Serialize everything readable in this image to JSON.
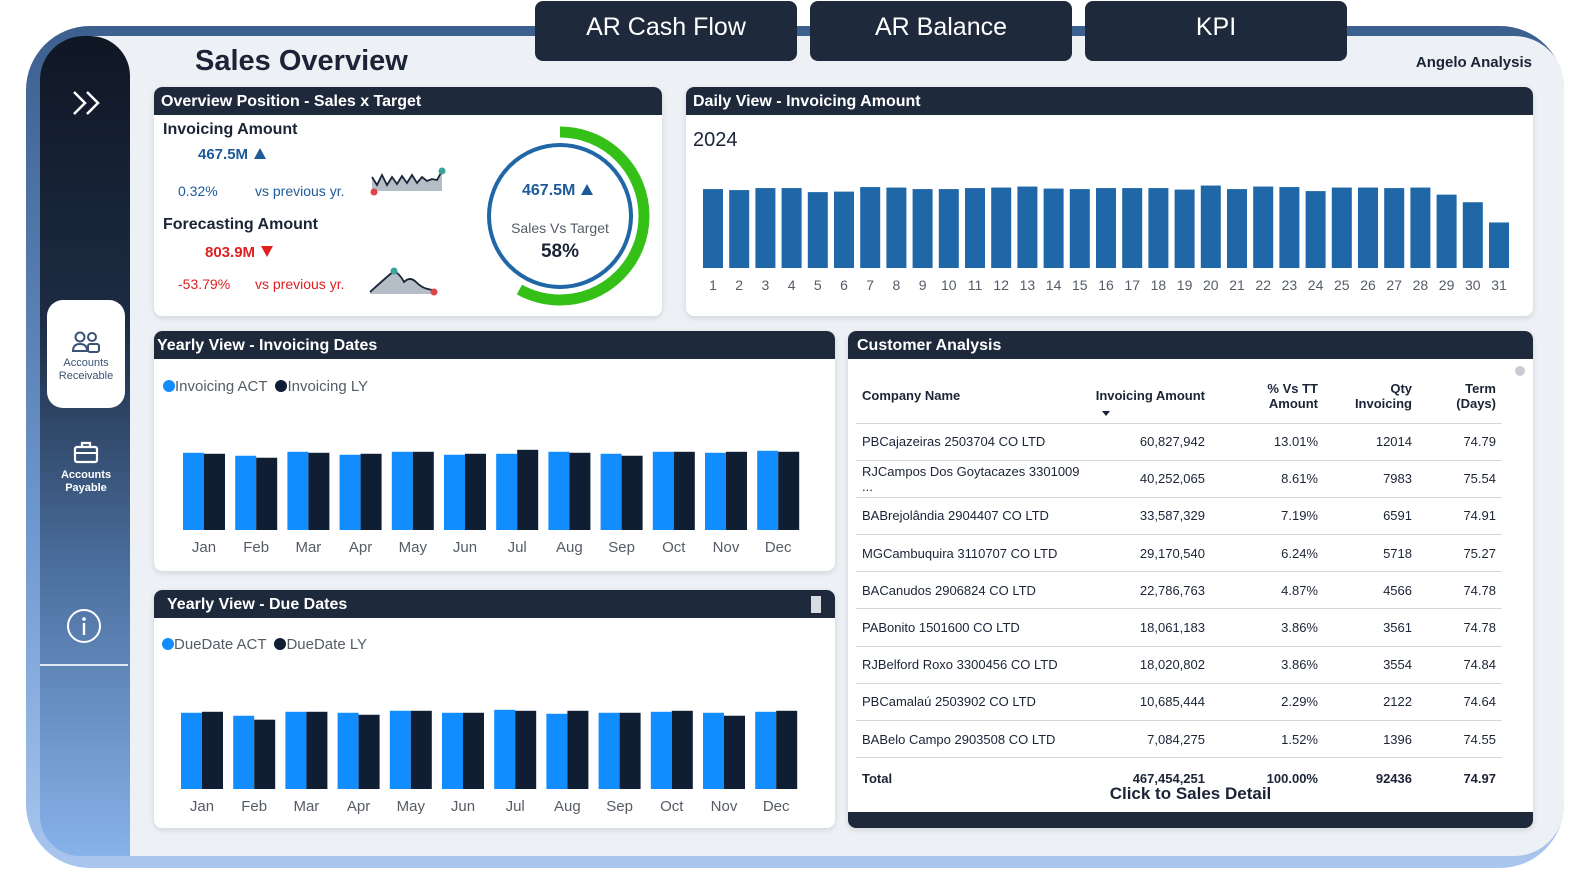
{
  "nav": {
    "top_tabs": [
      "AR Cash Flow",
      "AR Balance",
      "KPI"
    ],
    "sidebar": [
      {
        "label": "Accounts Receivable",
        "icon": "users-icon",
        "active": true
      },
      {
        "label": "Accounts Payable",
        "icon": "briefcase-icon",
        "active": false
      }
    ]
  },
  "header": {
    "title": "Sales Overview",
    "brand": "Angelo Analysis"
  },
  "overview": {
    "title": "Overview Position - Sales x Target",
    "invoicing": {
      "label": "Invoicing Amount",
      "value": "467.5M",
      "trend": "up",
      "pct": "0.32%",
      "compare": "vs previous yr."
    },
    "forecasting": {
      "label": "Forecasting Amount",
      "value": "803.9M",
      "trend": "down",
      "pct": "-53.79%",
      "compare": "vs previous yr."
    },
    "gauge": {
      "value": "467.5M",
      "label": "Sales Vs Target",
      "pct": "58%",
      "fraction": 0.58
    }
  },
  "daily": {
    "title": "Daily View - Invoicing Amount",
    "year": "2024"
  },
  "yearly_invoicing": {
    "title": "Yearly View - Invoicing Dates",
    "legend": [
      "Invoicing ACT",
      "Invoicing LY"
    ]
  },
  "yearly_due": {
    "title": "Yearly View - Due Dates",
    "legend": [
      "DueDate ACT",
      "DueDate LY"
    ]
  },
  "customer": {
    "title": "Customer Analysis",
    "columns": [
      "Company Name",
      "Invoicing Amount",
      "% Vs TT Amount",
      "Qty Invoicing",
      "Term (Days)"
    ],
    "rows": [
      [
        "PBCajazeiras 2503704 CO LTD",
        "60,827,942",
        "13.01%",
        "12014",
        "74.79"
      ],
      [
        "RJCampos Dos Goytacazes 3301009 ...",
        "40,252,065",
        "8.61%",
        "7983",
        "75.54"
      ],
      [
        "BABrejolândia 2904407 CO LTD",
        "33,587,329",
        "7.19%",
        "6591",
        "74.91"
      ],
      [
        "MGCambuquira 3110707 CO LTD",
        "29,170,540",
        "6.24%",
        "5718",
        "75.27"
      ],
      [
        "BACanudos 2906824 CO LTD",
        "22,786,763",
        "4.87%",
        "4566",
        "74.78"
      ],
      [
        "PABonito 1501600 CO LTD",
        "18,061,183",
        "3.86%",
        "3561",
        "74.78"
      ],
      [
        "RJBelford Roxo 3300456 CO LTD",
        "18,020,802",
        "3.86%",
        "3554",
        "74.84"
      ],
      [
        "PBCamalaú 2503902 CO LTD",
        "10,685,444",
        "2.29%",
        "2122",
        "74.64"
      ],
      [
        "BABelo Campo 2903508 CO LTD",
        "7,084,275",
        "1.52%",
        "1396",
        "74.55"
      ]
    ],
    "total": [
      "Total",
      "467,454,251",
      "100.00%",
      "92436",
      "74.97"
    ],
    "link": "Click to Sales Detail"
  },
  "colors": {
    "navy": "#1e2a3c",
    "bar_blue": "#1f67a7",
    "act_blue": "#118dff",
    "ly_dark": "#0f1e33",
    "gauge_green": "#35c018",
    "red": "#e01f1f"
  },
  "chart_data": [
    {
      "type": "bar",
      "title": "Daily View - Invoicing Amount",
      "subtitle": "2024",
      "categories": [
        "1",
        "2",
        "3",
        "4",
        "5",
        "6",
        "7",
        "8",
        "9",
        "10",
        "11",
        "12",
        "13",
        "14",
        "15",
        "16",
        "17",
        "18",
        "19",
        "20",
        "21",
        "22",
        "23",
        "24",
        "25",
        "26",
        "27",
        "28",
        "29",
        "30",
        "31"
      ],
      "values": [
        15.6,
        15.4,
        15.8,
        15.8,
        15.0,
        15.1,
        16.0,
        15.9,
        15.6,
        15.6,
        15.8,
        15.9,
        16.1,
        15.7,
        15.6,
        15.8,
        15.8,
        15.8,
        15.5,
        16.3,
        15.6,
        16.1,
        16.0,
        15.2,
        15.9,
        15.9,
        15.8,
        15.9,
        14.5,
        13.0,
        9.0
      ],
      "ylim": [
        0,
        17
      ]
    },
    {
      "type": "bar",
      "title": "Yearly View - Invoicing Dates",
      "categories": [
        "Jan",
        "Feb",
        "Mar",
        "Apr",
        "May",
        "Jun",
        "Jul",
        "Aug",
        "Sep",
        "Oct",
        "Nov",
        "Dec"
      ],
      "series": [
        {
          "name": "Invoicing ACT",
          "values": [
            39.0,
            37.5,
            39.5,
            38.0,
            39.5,
            38.0,
            38.5,
            39.5,
            38.5,
            39.5,
            39.0,
            40.0
          ]
        },
        {
          "name": "Invoicing LY",
          "values": [
            38.5,
            36.5,
            39.0,
            38.5,
            39.5,
            38.5,
            40.5,
            39.0,
            37.5,
            39.5,
            39.5,
            39.5
          ]
        }
      ],
      "ylim": [
        0,
        50
      ]
    },
    {
      "type": "bar",
      "title": "Yearly View - Due Dates",
      "categories": [
        "Jan",
        "Feb",
        "Mar",
        "Apr",
        "May",
        "Jun",
        "Jul",
        "Aug",
        "Sep",
        "Oct",
        "Nov",
        "Dec"
      ],
      "series": [
        {
          "name": "DueDate ACT",
          "values": [
            38.5,
            37.0,
            39.0,
            38.5,
            39.5,
            38.5,
            40.0,
            38.0,
            38.5,
            39.0,
            38.5,
            39.0
          ]
        },
        {
          "name": "DueDate LY",
          "values": [
            39.0,
            35.0,
            39.0,
            37.5,
            39.5,
            38.5,
            39.5,
            39.5,
            38.5,
            39.5,
            37.0,
            39.5
          ]
        }
      ],
      "ylim": [
        0,
        50
      ]
    }
  ]
}
